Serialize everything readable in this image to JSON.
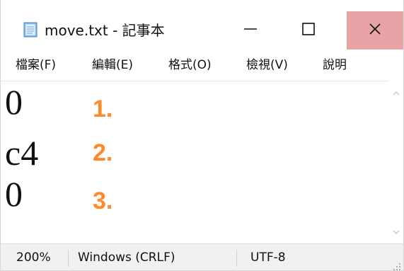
{
  "window": {
    "title": "move.txt - 記事本"
  },
  "controls": {
    "minimize_icon": "minimize-icon",
    "maximize_icon": "maximize-icon",
    "close_icon": "close-icon"
  },
  "menu": {
    "items": [
      {
        "label": "檔案(F)"
      },
      {
        "label": "編輯(E)"
      },
      {
        "label": "格式(O)"
      },
      {
        "label": "檢視(V)"
      },
      {
        "label": "說明"
      }
    ]
  },
  "editor": {
    "lines": [
      {
        "text": "0"
      },
      {
        "text": "c4"
      },
      {
        "text": "0"
      }
    ],
    "annotations": [
      {
        "text": "1."
      },
      {
        "text": "2."
      },
      {
        "text": "3."
      }
    ],
    "annotation_color": "#ff8a2a"
  },
  "scrollbar": {
    "up_icon": "chevron-up-icon",
    "down_icon": "chevron-down-icon"
  },
  "status": {
    "zoom": "200%",
    "line_endings": "Windows (CRLF)",
    "encoding": "UTF-8"
  },
  "colors": {
    "close_button": "#e8a3a6",
    "statusbar_background": "#f1f1f1"
  }
}
